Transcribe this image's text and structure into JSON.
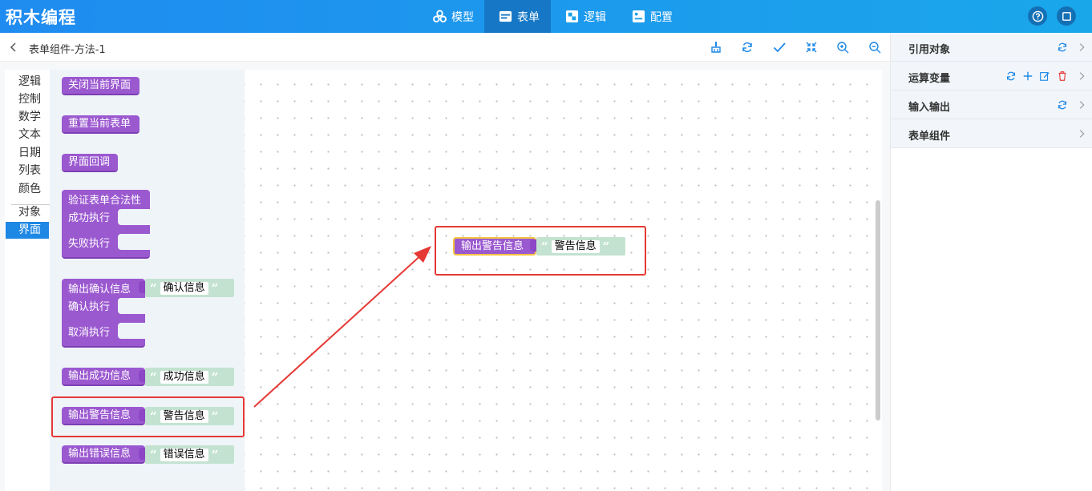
{
  "app": {
    "title": "积木编程"
  },
  "nav": {
    "tabs": [
      {
        "label": "模型",
        "icon": "model-icon"
      },
      {
        "label": "表单",
        "icon": "form-icon",
        "active": true
      },
      {
        "label": "逻辑",
        "icon": "logic-icon"
      },
      {
        "label": "配置",
        "icon": "config-icon"
      }
    ]
  },
  "header": {
    "breadcrumb": "表单组件-方法-1"
  },
  "categories": [
    "逻辑",
    "控制",
    "数学",
    "文本",
    "日期",
    "列表",
    "颜色",
    "对象",
    "界面"
  ],
  "active_category": "界面",
  "flyout": {
    "close_screen": "关闭当前界面",
    "reset_form": "重置当前表单",
    "ui_callback": "界面回调",
    "validate_form": "验证表单合法性",
    "on_success": "成功执行",
    "on_fail": "失败执行",
    "confirm_block": "输出确认信息",
    "confirm_text": "确认信息",
    "on_confirm": "确认执行",
    "on_cancel": "取消执行",
    "success_block": "输出成功信息",
    "success_text": "成功信息",
    "warning_block": "输出警告信息",
    "warning_text": "警告信息",
    "error_block": "输出错误信息",
    "error_text": "错误信息"
  },
  "workspace": {
    "block_label": "输出警告信息",
    "block_text": "警告信息"
  },
  "quotes": {
    "open": "“",
    "close": "”"
  },
  "right_panel": {
    "rows": [
      {
        "label": "引用对象"
      },
      {
        "label": "运算变量"
      },
      {
        "label": "输入输出"
      },
      {
        "label": "表单组件"
      }
    ]
  },
  "colors": {
    "topbar": "#1f8bf0",
    "block_purple": "#9b59d0",
    "string_green": "#c3e3d0",
    "highlight_red": "#e53935",
    "active_category": "#1e88e5"
  }
}
